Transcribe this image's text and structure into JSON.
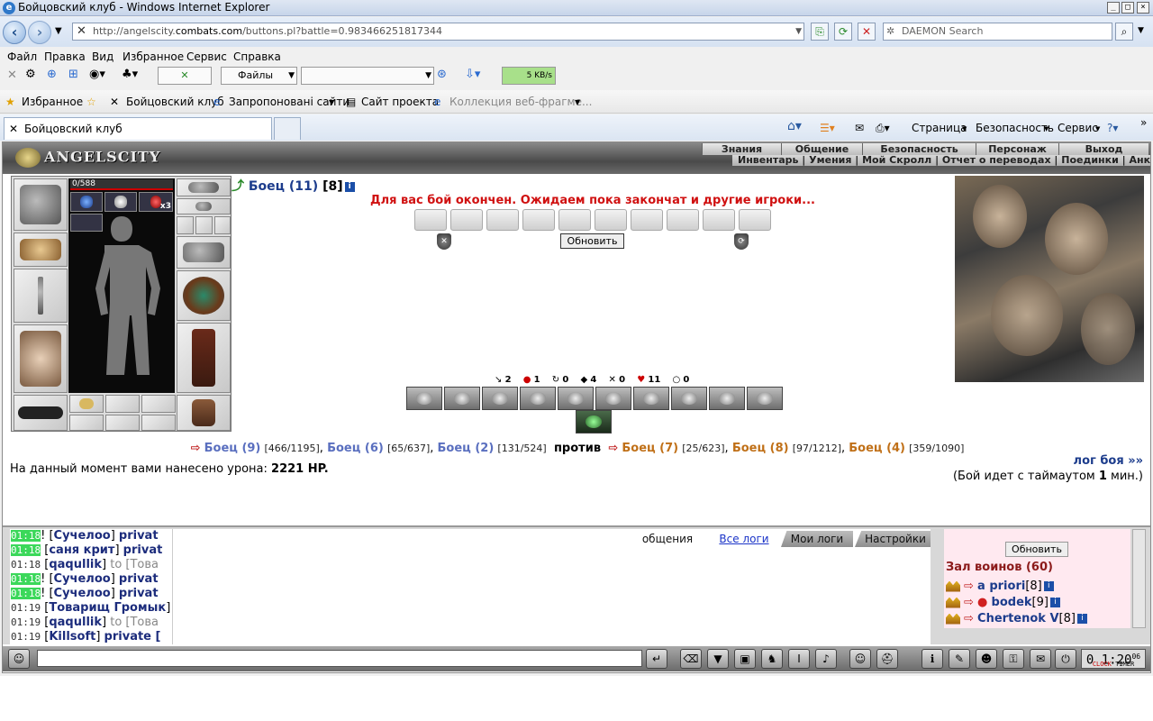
{
  "window": {
    "title": "Бойцовский клуб - Windows Internet Explorer"
  },
  "address": {
    "prefix": "http://angelscity.",
    "domain": "combats.com",
    "path": "/buttons.pl?battle=0.983466251817344",
    "search_placeholder": "DAEMON Search"
  },
  "menu": [
    "Файл",
    "Правка",
    "Вид",
    "Избранное",
    "Сервис",
    "Справка"
  ],
  "toolbar": {
    "files": "Файлы",
    "speed": "5 KB/s"
  },
  "favorites": {
    "label": "Избранное",
    "items": [
      "Бойцовский клуб",
      "Запропоновані сайти",
      "Сайт проекта",
      "Коллекция веб-фрагме..."
    ]
  },
  "tabs": {
    "active": "Бойцовский клуб"
  },
  "commandbar": [
    "Страница",
    "Безопасность",
    "Сервис"
  ],
  "game": {
    "logo": "ANGELSCITY",
    "menu1": [
      "Знания",
      "Общение",
      "Безопасность",
      "Персонаж",
      "Выход"
    ],
    "menu2": "Инвентарь | Умения | Мой Скролл | Отчет о переводах | Поединки | Анкета",
    "hp": "0/588",
    "item_count": "x3",
    "fighter": {
      "name": "Боец (11)",
      "level": "[8]"
    },
    "status": "Для вас бой окончен. Ожидаем пока закончат и другие игроки...",
    "refresh": "Обновить",
    "stats": [
      "2",
      "1",
      "0",
      "4",
      "0",
      "11",
      "0"
    ],
    "team1": [
      {
        "name": "Боец (9)",
        "hp": "[466/1195]"
      },
      {
        "name": "Боец (6)",
        "hp": "[65/637]"
      },
      {
        "name": "Боец (2)",
        "hp": "[131/524]"
      }
    ],
    "vs": "против",
    "team2": [
      {
        "name": "Боец (7)",
        "hp": "[25/623]"
      },
      {
        "name": "Боец (8)",
        "hp": "[97/1212]"
      },
      {
        "name": "Боец (4)",
        "hp": "[359/1090]"
      }
    ],
    "damage_label": "На данный момент вами нанесено урона:",
    "damage_value": "2221 HP.",
    "log_link": "лог боя »»",
    "timeout_pre": "(Бой идет с таймаутом",
    "timeout_val": "1",
    "timeout_post": "мин.)"
  },
  "chat": {
    "lines": [
      {
        "time": "01:18",
        "hl": true,
        "nick": "Сучелоо",
        "rest": "privat"
      },
      {
        "time": "01:18",
        "hl": true,
        "nick": "саня крит",
        "rest": "privat"
      },
      {
        "time": "01:18",
        "hl": false,
        "nick": "qaqullik",
        "rest": "to [Това"
      },
      {
        "time": "01:18",
        "hl": true,
        "nick": "Сучелоо",
        "rest": "privat"
      },
      {
        "time": "01:18",
        "hl": true,
        "nick": "Сучелоо",
        "rest": "privat"
      },
      {
        "time": "01:19",
        "hl": false,
        "nick": "Товарищ Громык",
        "rest": ""
      },
      {
        "time": "01:19",
        "hl": false,
        "nick": "qaqullik",
        "rest": "to [Това"
      },
      {
        "time": "01:19",
        "hl": false,
        "nick": "Killsoft",
        "rest": "private ["
      }
    ],
    "tabs": [
      "общения",
      "Все логи",
      "Мои логи",
      "Настройки"
    ]
  },
  "room": {
    "refresh": "Обновить",
    "title": "Зал воинов (60)",
    "users": [
      {
        "name": "a priori",
        "lvl": "[8]"
      },
      {
        "name": "bodek",
        "lvl": "[9]"
      },
      {
        "name": "Chertenok V",
        "lvl": "[8]"
      }
    ]
  },
  "clock": {
    "time": "0 1:20",
    "sec": "06",
    "l1": "CLOCK",
    "l2": "TIMER"
  }
}
